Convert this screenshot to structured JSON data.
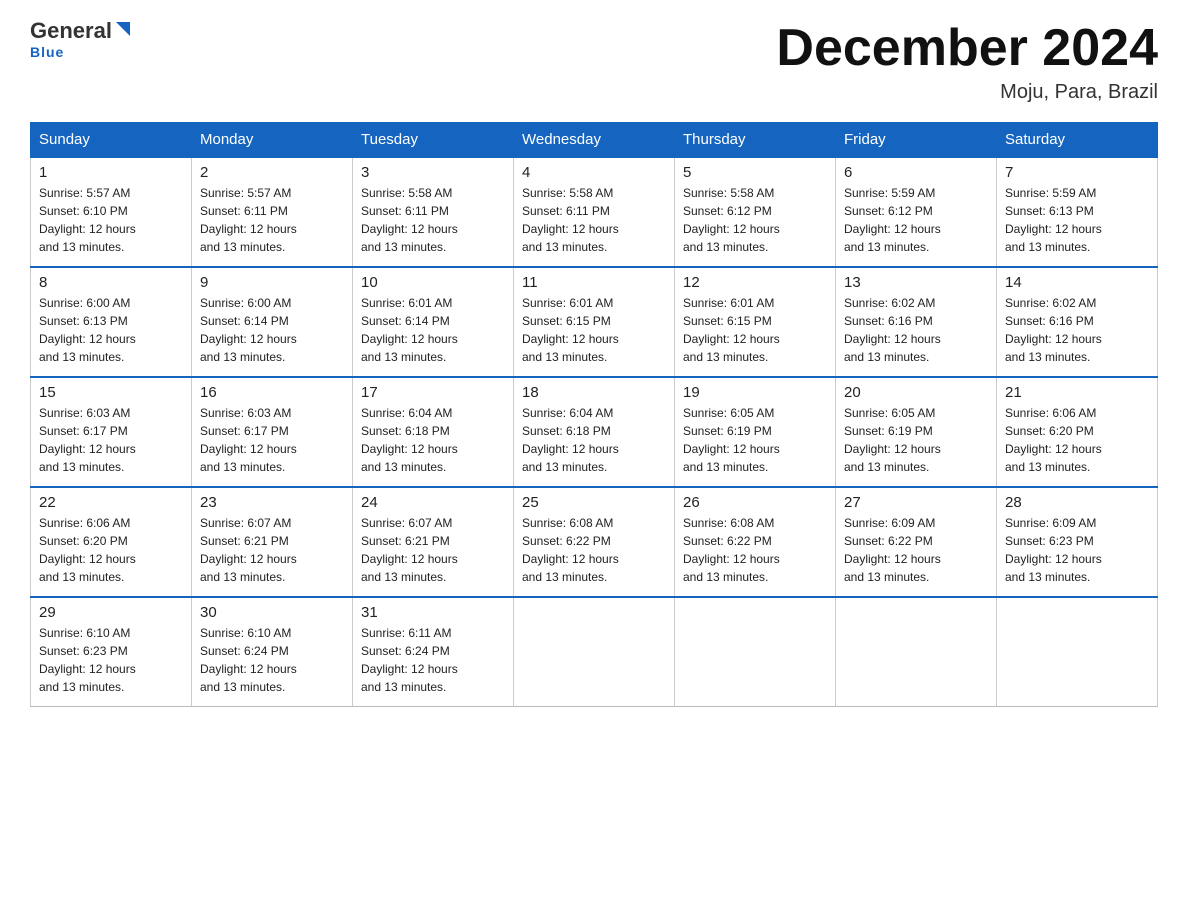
{
  "header": {
    "logo_general": "General",
    "logo_blue": "Blue",
    "title": "December 2024",
    "subtitle": "Moju, Para, Brazil"
  },
  "weekdays": [
    "Sunday",
    "Monday",
    "Tuesday",
    "Wednesday",
    "Thursday",
    "Friday",
    "Saturday"
  ],
  "weeks": [
    [
      {
        "day": "1",
        "info": "Sunrise: 5:57 AM\nSunset: 6:10 PM\nDaylight: 12 hours\nand 13 minutes."
      },
      {
        "day": "2",
        "info": "Sunrise: 5:57 AM\nSunset: 6:11 PM\nDaylight: 12 hours\nand 13 minutes."
      },
      {
        "day": "3",
        "info": "Sunrise: 5:58 AM\nSunset: 6:11 PM\nDaylight: 12 hours\nand 13 minutes."
      },
      {
        "day": "4",
        "info": "Sunrise: 5:58 AM\nSunset: 6:11 PM\nDaylight: 12 hours\nand 13 minutes."
      },
      {
        "day": "5",
        "info": "Sunrise: 5:58 AM\nSunset: 6:12 PM\nDaylight: 12 hours\nand 13 minutes."
      },
      {
        "day": "6",
        "info": "Sunrise: 5:59 AM\nSunset: 6:12 PM\nDaylight: 12 hours\nand 13 minutes."
      },
      {
        "day": "7",
        "info": "Sunrise: 5:59 AM\nSunset: 6:13 PM\nDaylight: 12 hours\nand 13 minutes."
      }
    ],
    [
      {
        "day": "8",
        "info": "Sunrise: 6:00 AM\nSunset: 6:13 PM\nDaylight: 12 hours\nand 13 minutes."
      },
      {
        "day": "9",
        "info": "Sunrise: 6:00 AM\nSunset: 6:14 PM\nDaylight: 12 hours\nand 13 minutes."
      },
      {
        "day": "10",
        "info": "Sunrise: 6:01 AM\nSunset: 6:14 PM\nDaylight: 12 hours\nand 13 minutes."
      },
      {
        "day": "11",
        "info": "Sunrise: 6:01 AM\nSunset: 6:15 PM\nDaylight: 12 hours\nand 13 minutes."
      },
      {
        "day": "12",
        "info": "Sunrise: 6:01 AM\nSunset: 6:15 PM\nDaylight: 12 hours\nand 13 minutes."
      },
      {
        "day": "13",
        "info": "Sunrise: 6:02 AM\nSunset: 6:16 PM\nDaylight: 12 hours\nand 13 minutes."
      },
      {
        "day": "14",
        "info": "Sunrise: 6:02 AM\nSunset: 6:16 PM\nDaylight: 12 hours\nand 13 minutes."
      }
    ],
    [
      {
        "day": "15",
        "info": "Sunrise: 6:03 AM\nSunset: 6:17 PM\nDaylight: 12 hours\nand 13 minutes."
      },
      {
        "day": "16",
        "info": "Sunrise: 6:03 AM\nSunset: 6:17 PM\nDaylight: 12 hours\nand 13 minutes."
      },
      {
        "day": "17",
        "info": "Sunrise: 6:04 AM\nSunset: 6:18 PM\nDaylight: 12 hours\nand 13 minutes."
      },
      {
        "day": "18",
        "info": "Sunrise: 6:04 AM\nSunset: 6:18 PM\nDaylight: 12 hours\nand 13 minutes."
      },
      {
        "day": "19",
        "info": "Sunrise: 6:05 AM\nSunset: 6:19 PM\nDaylight: 12 hours\nand 13 minutes."
      },
      {
        "day": "20",
        "info": "Sunrise: 6:05 AM\nSunset: 6:19 PM\nDaylight: 12 hours\nand 13 minutes."
      },
      {
        "day": "21",
        "info": "Sunrise: 6:06 AM\nSunset: 6:20 PM\nDaylight: 12 hours\nand 13 minutes."
      }
    ],
    [
      {
        "day": "22",
        "info": "Sunrise: 6:06 AM\nSunset: 6:20 PM\nDaylight: 12 hours\nand 13 minutes."
      },
      {
        "day": "23",
        "info": "Sunrise: 6:07 AM\nSunset: 6:21 PM\nDaylight: 12 hours\nand 13 minutes."
      },
      {
        "day": "24",
        "info": "Sunrise: 6:07 AM\nSunset: 6:21 PM\nDaylight: 12 hours\nand 13 minutes."
      },
      {
        "day": "25",
        "info": "Sunrise: 6:08 AM\nSunset: 6:22 PM\nDaylight: 12 hours\nand 13 minutes."
      },
      {
        "day": "26",
        "info": "Sunrise: 6:08 AM\nSunset: 6:22 PM\nDaylight: 12 hours\nand 13 minutes."
      },
      {
        "day": "27",
        "info": "Sunrise: 6:09 AM\nSunset: 6:22 PM\nDaylight: 12 hours\nand 13 minutes."
      },
      {
        "day": "28",
        "info": "Sunrise: 6:09 AM\nSunset: 6:23 PM\nDaylight: 12 hours\nand 13 minutes."
      }
    ],
    [
      {
        "day": "29",
        "info": "Sunrise: 6:10 AM\nSunset: 6:23 PM\nDaylight: 12 hours\nand 13 minutes."
      },
      {
        "day": "30",
        "info": "Sunrise: 6:10 AM\nSunset: 6:24 PM\nDaylight: 12 hours\nand 13 minutes."
      },
      {
        "day": "31",
        "info": "Sunrise: 6:11 AM\nSunset: 6:24 PM\nDaylight: 12 hours\nand 13 minutes."
      },
      {
        "day": "",
        "info": ""
      },
      {
        "day": "",
        "info": ""
      },
      {
        "day": "",
        "info": ""
      },
      {
        "day": "",
        "info": ""
      }
    ]
  ]
}
